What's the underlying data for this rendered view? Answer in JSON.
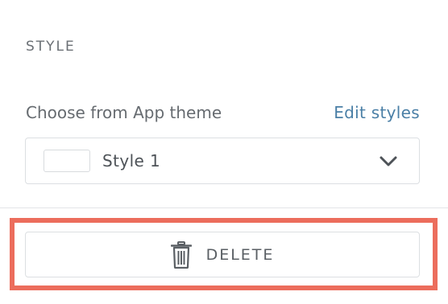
{
  "style_section": {
    "title": "STYLE",
    "choose_label": "Choose from App theme",
    "edit_link": "Edit styles",
    "select": {
      "value": "Style 1",
      "swatch_color": "#ffffff",
      "icon": "chevron-down-icon"
    }
  },
  "actions": {
    "delete_label": "DELETE",
    "delete_icon": "trash-icon",
    "highlight_color": "#ec6d5c"
  }
}
